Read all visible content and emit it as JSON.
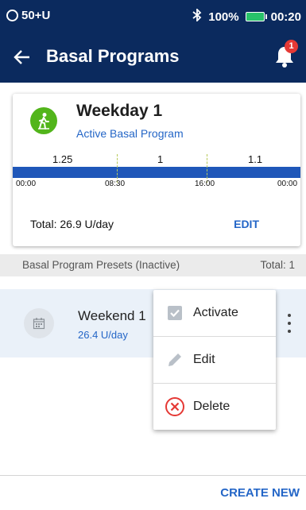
{
  "status_bar": {
    "left_text": "50+U",
    "battery": "100%",
    "time": "00:20"
  },
  "app_bar": {
    "title": "Basal Programs",
    "notification_count": "1"
  },
  "active_program": {
    "name": "Weekday 1",
    "subtitle": "Active Basal Program",
    "segment_rates": [
      "1.25",
      "1",
      "1.1"
    ],
    "time_labels": [
      "00:00",
      "08:30",
      "16:00",
      "00:00"
    ],
    "total": "Total: 26.9 U/day",
    "edit_label": "EDIT"
  },
  "presets": {
    "header_label": "Basal Program Presets (Inactive)",
    "header_total": "Total: 1",
    "items": [
      {
        "name": "Weekend 1",
        "rate": "26.4 U/day"
      }
    ]
  },
  "context_menu": {
    "activate": "Activate",
    "edit": "Edit",
    "delete": "Delete"
  },
  "footer": {
    "create_new": "CREATE NEW"
  },
  "colors": {
    "header_bg": "#0b2a5e",
    "accent": "#2466c7",
    "active_icon": "#52b51b",
    "delete_red": "#e53935"
  },
  "icons": [
    "clock-icon",
    "bluetooth-icon",
    "battery-icon",
    "back-arrow-icon",
    "bell-icon",
    "walking-person-icon",
    "calendar-icon",
    "more-vertical-icon",
    "checkbox-icon",
    "pencil-icon",
    "cancel-circle-icon"
  ]
}
